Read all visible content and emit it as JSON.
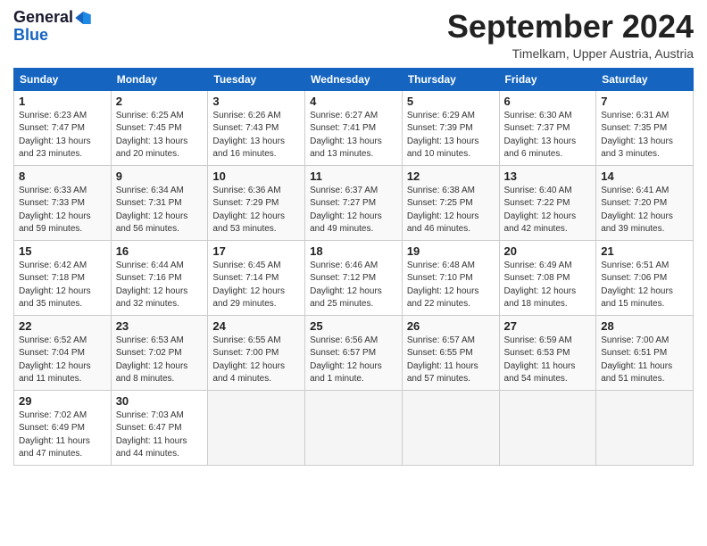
{
  "logo": {
    "line1": "General",
    "line2": "Blue"
  },
  "title": "September 2024",
  "location": "Timelkam, Upper Austria, Austria",
  "weekdays": [
    "Sunday",
    "Monday",
    "Tuesday",
    "Wednesday",
    "Thursday",
    "Friday",
    "Saturday"
  ],
  "weeks": [
    [
      {
        "day": "1",
        "info": "Sunrise: 6:23 AM\nSunset: 7:47 PM\nDaylight: 13 hours\nand 23 minutes."
      },
      {
        "day": "2",
        "info": "Sunrise: 6:25 AM\nSunset: 7:45 PM\nDaylight: 13 hours\nand 20 minutes."
      },
      {
        "day": "3",
        "info": "Sunrise: 6:26 AM\nSunset: 7:43 PM\nDaylight: 13 hours\nand 16 minutes."
      },
      {
        "day": "4",
        "info": "Sunrise: 6:27 AM\nSunset: 7:41 PM\nDaylight: 13 hours\nand 13 minutes."
      },
      {
        "day": "5",
        "info": "Sunrise: 6:29 AM\nSunset: 7:39 PM\nDaylight: 13 hours\nand 10 minutes."
      },
      {
        "day": "6",
        "info": "Sunrise: 6:30 AM\nSunset: 7:37 PM\nDaylight: 13 hours\nand 6 minutes."
      },
      {
        "day": "7",
        "info": "Sunrise: 6:31 AM\nSunset: 7:35 PM\nDaylight: 13 hours\nand 3 minutes."
      }
    ],
    [
      {
        "day": "8",
        "info": "Sunrise: 6:33 AM\nSunset: 7:33 PM\nDaylight: 12 hours\nand 59 minutes."
      },
      {
        "day": "9",
        "info": "Sunrise: 6:34 AM\nSunset: 7:31 PM\nDaylight: 12 hours\nand 56 minutes."
      },
      {
        "day": "10",
        "info": "Sunrise: 6:36 AM\nSunset: 7:29 PM\nDaylight: 12 hours\nand 53 minutes."
      },
      {
        "day": "11",
        "info": "Sunrise: 6:37 AM\nSunset: 7:27 PM\nDaylight: 12 hours\nand 49 minutes."
      },
      {
        "day": "12",
        "info": "Sunrise: 6:38 AM\nSunset: 7:25 PM\nDaylight: 12 hours\nand 46 minutes."
      },
      {
        "day": "13",
        "info": "Sunrise: 6:40 AM\nSunset: 7:22 PM\nDaylight: 12 hours\nand 42 minutes."
      },
      {
        "day": "14",
        "info": "Sunrise: 6:41 AM\nSunset: 7:20 PM\nDaylight: 12 hours\nand 39 minutes."
      }
    ],
    [
      {
        "day": "15",
        "info": "Sunrise: 6:42 AM\nSunset: 7:18 PM\nDaylight: 12 hours\nand 35 minutes."
      },
      {
        "day": "16",
        "info": "Sunrise: 6:44 AM\nSunset: 7:16 PM\nDaylight: 12 hours\nand 32 minutes."
      },
      {
        "day": "17",
        "info": "Sunrise: 6:45 AM\nSunset: 7:14 PM\nDaylight: 12 hours\nand 29 minutes."
      },
      {
        "day": "18",
        "info": "Sunrise: 6:46 AM\nSunset: 7:12 PM\nDaylight: 12 hours\nand 25 minutes."
      },
      {
        "day": "19",
        "info": "Sunrise: 6:48 AM\nSunset: 7:10 PM\nDaylight: 12 hours\nand 22 minutes."
      },
      {
        "day": "20",
        "info": "Sunrise: 6:49 AM\nSunset: 7:08 PM\nDaylight: 12 hours\nand 18 minutes."
      },
      {
        "day": "21",
        "info": "Sunrise: 6:51 AM\nSunset: 7:06 PM\nDaylight: 12 hours\nand 15 minutes."
      }
    ],
    [
      {
        "day": "22",
        "info": "Sunrise: 6:52 AM\nSunset: 7:04 PM\nDaylight: 12 hours\nand 11 minutes."
      },
      {
        "day": "23",
        "info": "Sunrise: 6:53 AM\nSunset: 7:02 PM\nDaylight: 12 hours\nand 8 minutes."
      },
      {
        "day": "24",
        "info": "Sunrise: 6:55 AM\nSunset: 7:00 PM\nDaylight: 12 hours\nand 4 minutes."
      },
      {
        "day": "25",
        "info": "Sunrise: 6:56 AM\nSunset: 6:57 PM\nDaylight: 12 hours\nand 1 minute."
      },
      {
        "day": "26",
        "info": "Sunrise: 6:57 AM\nSunset: 6:55 PM\nDaylight: 11 hours\nand 57 minutes."
      },
      {
        "day": "27",
        "info": "Sunrise: 6:59 AM\nSunset: 6:53 PM\nDaylight: 11 hours\nand 54 minutes."
      },
      {
        "day": "28",
        "info": "Sunrise: 7:00 AM\nSunset: 6:51 PM\nDaylight: 11 hours\nand 51 minutes."
      }
    ],
    [
      {
        "day": "29",
        "info": "Sunrise: 7:02 AM\nSunset: 6:49 PM\nDaylight: 11 hours\nand 47 minutes."
      },
      {
        "day": "30",
        "info": "Sunrise: 7:03 AM\nSunset: 6:47 PM\nDaylight: 11 hours\nand 44 minutes."
      },
      {
        "day": "",
        "info": ""
      },
      {
        "day": "",
        "info": ""
      },
      {
        "day": "",
        "info": ""
      },
      {
        "day": "",
        "info": ""
      },
      {
        "day": "",
        "info": ""
      }
    ]
  ]
}
